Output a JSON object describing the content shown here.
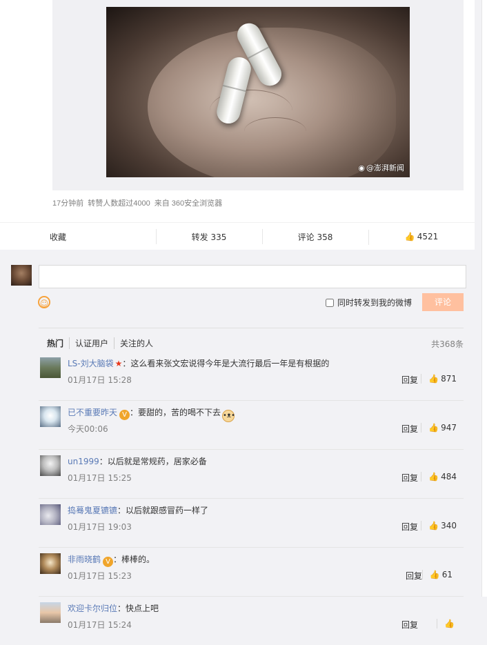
{
  "post": {
    "image_watermark": "@澎湃新闻",
    "meta": {
      "time": "17分钟前",
      "reposts_note": "转赞人数超过4000",
      "source": "来自 360安全浏览器"
    },
    "actions": {
      "favorite": "收藏",
      "repost": "转发 335",
      "comment": "评论 358",
      "like": "4521"
    }
  },
  "composer": {
    "input_value": "",
    "forward_label": "同时转发到我的微博",
    "submit_label": "评论"
  },
  "comment_tabs": {
    "tabs": [
      "热门",
      "认证用户",
      "关注的人"
    ],
    "total": "共368条"
  },
  "comments": [
    {
      "name": "LS-刘大脑袋",
      "badge": "star",
      "text": "：这么看来张文宏说得今年是大流行最后一年是有根据的",
      "time": "01月17日 15:28",
      "reply": "回复",
      "likes": "871"
    },
    {
      "name": "已不重要昨天",
      "badge": "v",
      "text": "：要甜的，苦的喝不下去",
      "emoji": "dog",
      "time": "今天00:06",
      "reply": "回复",
      "likes": "947"
    },
    {
      "name": "un1999",
      "badge": "",
      "text": "：以后就是常规药，居家必备",
      "time": "01月17日 15:25",
      "reply": "回复",
      "likes": "484"
    },
    {
      "name": "捣蓦鬼夏镳镳",
      "badge": "",
      "text": "：以后就跟感冒药一样了",
      "time": "01月17日 19:03",
      "reply": "回复",
      "likes": "340"
    },
    {
      "name": "非雨晓鹤",
      "badge": "v",
      "text": "：棒棒的。",
      "time": "01月17日 15:23",
      "reply": "回复",
      "likes": "61"
    },
    {
      "name": "欢迎卡尔归位",
      "badge": "",
      "text": "：快点上吧",
      "time": "01月17日 15:24",
      "reply": "回复",
      "likes": ""
    }
  ],
  "colors": {
    "link": "#5a7ab6",
    "submit_disabled": "#ffc09f",
    "emoji_orange": "#f7a23b",
    "star_red": "#e8381c",
    "v_badge": "#f0a52b"
  },
  "icons": {
    "like": "thumb-up-icon",
    "emoji": "smiley-icon",
    "watermark": "weibo-icon"
  }
}
